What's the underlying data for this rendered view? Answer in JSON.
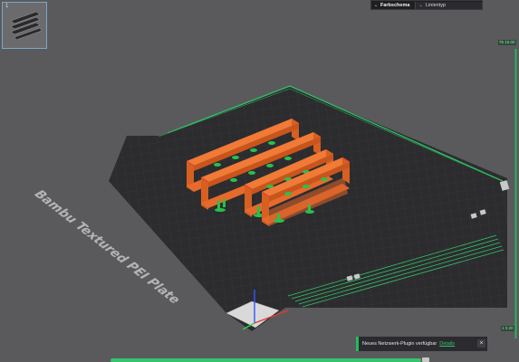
{
  "plate": {
    "name": "Bambu Textured PEI Plate",
    "index": "1"
  },
  "toolbar": {
    "color_scheme_label": "Farbschema",
    "color_scheme_value": "Linientyp"
  },
  "layer_slider": {
    "top_label": "75 15.00",
    "bottom_label": "1 0.20"
  },
  "notification": {
    "message": "Neues Netzwerk-Plugin verfügbar",
    "link": "Details"
  },
  "icons": {
    "dropdown": "chevron-down-icon",
    "close": "close-icon",
    "axes": "axes-gizmo-icon"
  },
  "colors": {
    "background": "#5a5a5c",
    "bed": "#2f2f31",
    "grid": "#3a3a3d",
    "wall": "#e2692b",
    "support": "#27c24a",
    "accent": "#1fbd5a",
    "red": "#e53935"
  }
}
